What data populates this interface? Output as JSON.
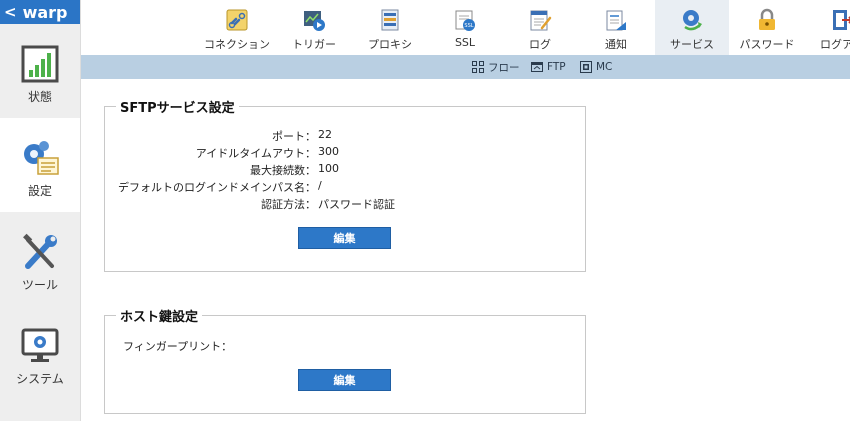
{
  "brand": {
    "back_symbol": "<",
    "name": "warp"
  },
  "sidebar": {
    "items": [
      {
        "label": "状態",
        "icon": "status-chart-icon"
      },
      {
        "label": "設定",
        "icon": "settings-gears-icon"
      },
      {
        "label": "ツール",
        "icon": "tools-wrench-icon"
      },
      {
        "label": "システム",
        "icon": "system-monitor-icon"
      }
    ]
  },
  "tabs": [
    {
      "label": "コネクション",
      "icon": "connection-icon"
    },
    {
      "label": "トリガー",
      "icon": "trigger-icon"
    },
    {
      "label": "プロキシ",
      "icon": "proxy-icon"
    },
    {
      "label": "SSL",
      "icon": "ssl-icon"
    },
    {
      "label": "ログ",
      "icon": "log-icon"
    },
    {
      "label": "通知",
      "icon": "notification-icon"
    },
    {
      "label": "サービス",
      "icon": "service-icon"
    },
    {
      "label": "パスワード",
      "icon": "password-lock-icon"
    },
    {
      "label": "ログアウ",
      "icon": "logout-icon"
    }
  ],
  "subtabs": [
    {
      "label": "フロー",
      "icon": "flow-icon"
    },
    {
      "label": "FTP",
      "icon": "ftp-icon"
    },
    {
      "label": "MC",
      "icon": "mc-icon"
    }
  ],
  "sftp": {
    "title": "SFTPサービス設定",
    "rows": [
      {
        "key": "ポート：",
        "value": "22"
      },
      {
        "key": "アイドルタイムアウト：",
        "value": "300"
      },
      {
        "key": "最大接続数：",
        "value": "100"
      },
      {
        "key": "デフォルトのログインドメインパス名：",
        "value": "/"
      },
      {
        "key": "認証方法：",
        "value": "パスワード認証"
      }
    ],
    "edit_label": "編集"
  },
  "hostkey": {
    "title": "ホスト鍵設定",
    "fingerprint_label": "フィンガープリント：",
    "edit_label": "編集"
  },
  "colors": {
    "accent": "#2b75c6",
    "subbar": "#b9cfe2",
    "button": "#2d78c8"
  }
}
